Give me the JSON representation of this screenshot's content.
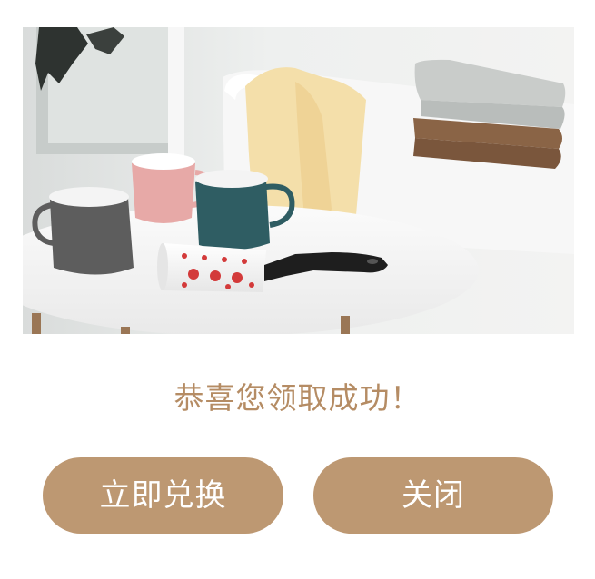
{
  "dialog": {
    "message": "恭喜您领取成功！",
    "redeem_label": "立即兑换",
    "close_label": "关闭"
  },
  "image": {
    "subject": "lint-roller-with-mugs-and-towels",
    "colors": {
      "background": "#eceded",
      "table": "#f4f4f4",
      "mug_gray": "#5d5d5d",
      "mug_pink": "#e7a9a7",
      "mug_teal": "#2f5d63",
      "towel_yellow": "#f4dfaa",
      "towel_gray": "#c9ccca",
      "towel_brown": "#8a6446",
      "roller_handle": "#1e1e1e",
      "roller_print": "#d33a3a"
    }
  },
  "theme": {
    "accent": "#bd9872",
    "message_color": "#b58c64",
    "button_text": "#ffffff"
  }
}
